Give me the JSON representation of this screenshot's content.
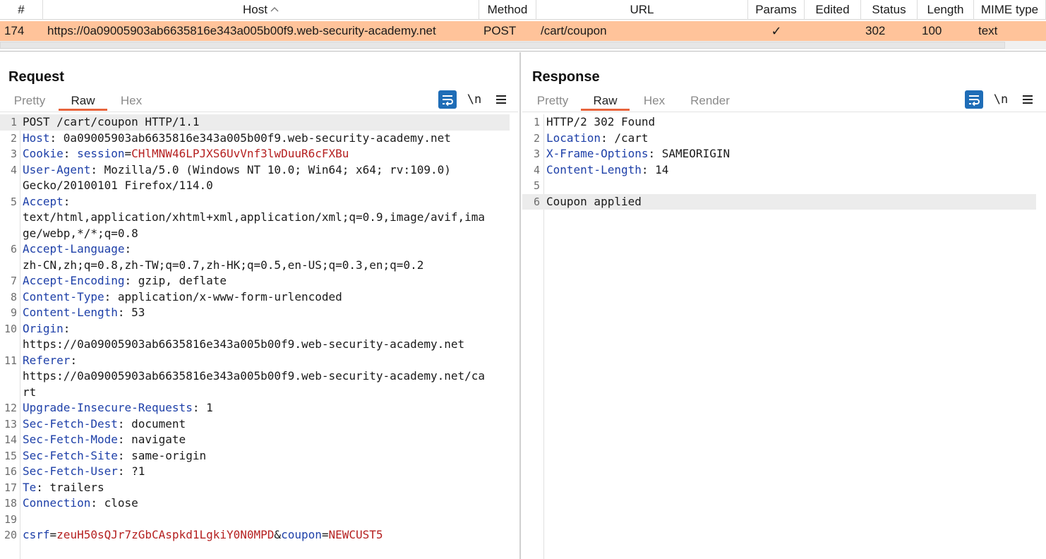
{
  "history": {
    "columns": [
      "#",
      "Host",
      "Method",
      "URL",
      "Params",
      "Edited",
      "Status",
      "Length",
      "MIME type"
    ],
    "row": {
      "num": "174",
      "host": "https://0a09005903ab6635816e343a005b00f9.web-security-academy.net",
      "method": "POST",
      "url": "/cart/coupon",
      "params": "✓",
      "edited": "",
      "status": "302",
      "length": "100",
      "mime": "text"
    },
    "row_color": "#ffc39a"
  },
  "request": {
    "title": "Request",
    "tabs": [
      "Pretty",
      "Raw",
      "Hex"
    ],
    "active_tab": "Raw",
    "newline_label": "\\n",
    "lines": [
      {
        "n": "1",
        "plain": "POST /cart/coupon HTTP/1.1"
      },
      {
        "n": "2",
        "key": "Host",
        "value": ": 0a09005903ab6635816e343a005b00f9.web-security-academy.net"
      },
      {
        "n": "3",
        "key": "Cookie",
        "value": ": ",
        "ck": "session",
        "eq": "=",
        "cv": "CHlMNW46LPJXS6UvVnf3lwDuuR6cFXBu"
      },
      {
        "n": "4",
        "key": "User-Agent",
        "value": ": Mozilla/5.0 (Windows NT 10.0; Win64; x64; rv:109.0)"
      },
      {
        "n": "",
        "plain": "Gecko/20100101 Firefox/114.0"
      },
      {
        "n": "5",
        "key": "Accept",
        "value": ":"
      },
      {
        "n": "",
        "plain": "text/html,application/xhtml+xml,application/xml;q=0.9,image/avif,ima"
      },
      {
        "n": "",
        "plain": "ge/webp,*/*;q=0.8"
      },
      {
        "n": "6",
        "key": "Accept-Language",
        "value": ":"
      },
      {
        "n": "",
        "plain": "zh-CN,zh;q=0.8,zh-TW;q=0.7,zh-HK;q=0.5,en-US;q=0.3,en;q=0.2"
      },
      {
        "n": "7",
        "key": "Accept-Encoding",
        "value": ": gzip, deflate"
      },
      {
        "n": "8",
        "key": "Content-Type",
        "value": ": application/x-www-form-urlencoded"
      },
      {
        "n": "9",
        "key": "Content-Length",
        "value": ": 53"
      },
      {
        "n": "10",
        "key": "Origin",
        "value": ":"
      },
      {
        "n": "",
        "plain": "https://0a09005903ab6635816e343a005b00f9.web-security-academy.net"
      },
      {
        "n": "11",
        "key": "Referer",
        "value": ":"
      },
      {
        "n": "",
        "plain": "https://0a09005903ab6635816e343a005b00f9.web-security-academy.net/ca"
      },
      {
        "n": "",
        "plain": "rt"
      },
      {
        "n": "12",
        "key": "Upgrade-Insecure-Requests",
        "value": ": 1"
      },
      {
        "n": "13",
        "key": "Sec-Fetch-Dest",
        "value": ": document"
      },
      {
        "n": "14",
        "key": "Sec-Fetch-Mode",
        "value": ": navigate"
      },
      {
        "n": "15",
        "key": "Sec-Fetch-Site",
        "value": ": same-origin"
      },
      {
        "n": "16",
        "key": "Sec-Fetch-User",
        "value": ": ?1"
      },
      {
        "n": "17",
        "key": "Te",
        "value": ": trailers"
      },
      {
        "n": "18",
        "key": "Connection",
        "value": ": close"
      },
      {
        "n": "19",
        "plain": ""
      },
      {
        "n": "20",
        "body": [
          {
            "k": "csrf"
          },
          {
            "p": "="
          },
          {
            "v": "zeuH50sQJr7zGbCAspkd1LgkiY0N0MPD"
          },
          {
            "p": "&"
          },
          {
            "k": "coupon"
          },
          {
            "p": "="
          },
          {
            "v": "NEWCUST5"
          }
        ]
      }
    ]
  },
  "response": {
    "title": "Response",
    "tabs": [
      "Pretty",
      "Raw",
      "Hex",
      "Render"
    ],
    "active_tab": "Raw",
    "newline_label": "\\n",
    "lines": [
      {
        "n": "1",
        "plain": "HTTP/2 302 Found"
      },
      {
        "n": "2",
        "key": "Location",
        "value": ": /cart"
      },
      {
        "n": "3",
        "key": "X-Frame-Options",
        "value": ": SAMEORIGIN"
      },
      {
        "n": "4",
        "key": "Content-Length",
        "value": ": 14"
      },
      {
        "n": "5",
        "plain": ""
      },
      {
        "n": "6",
        "plain": "Coupon applied"
      }
    ]
  },
  "colors": {
    "accent_tab": "#e8643c",
    "icon_blue": "#1f6db7",
    "header_key": "#1d3fa8",
    "cookie_value": "#b52020"
  },
  "icons": {
    "sort": "sort-ascending-icon",
    "wrap": "word-wrap-icon",
    "menu": "hamburger-menu-icon",
    "layout": [
      "layout-split-horizontal-icon",
      "layout-split-vertical-icon",
      "layout-single-icon"
    ]
  }
}
